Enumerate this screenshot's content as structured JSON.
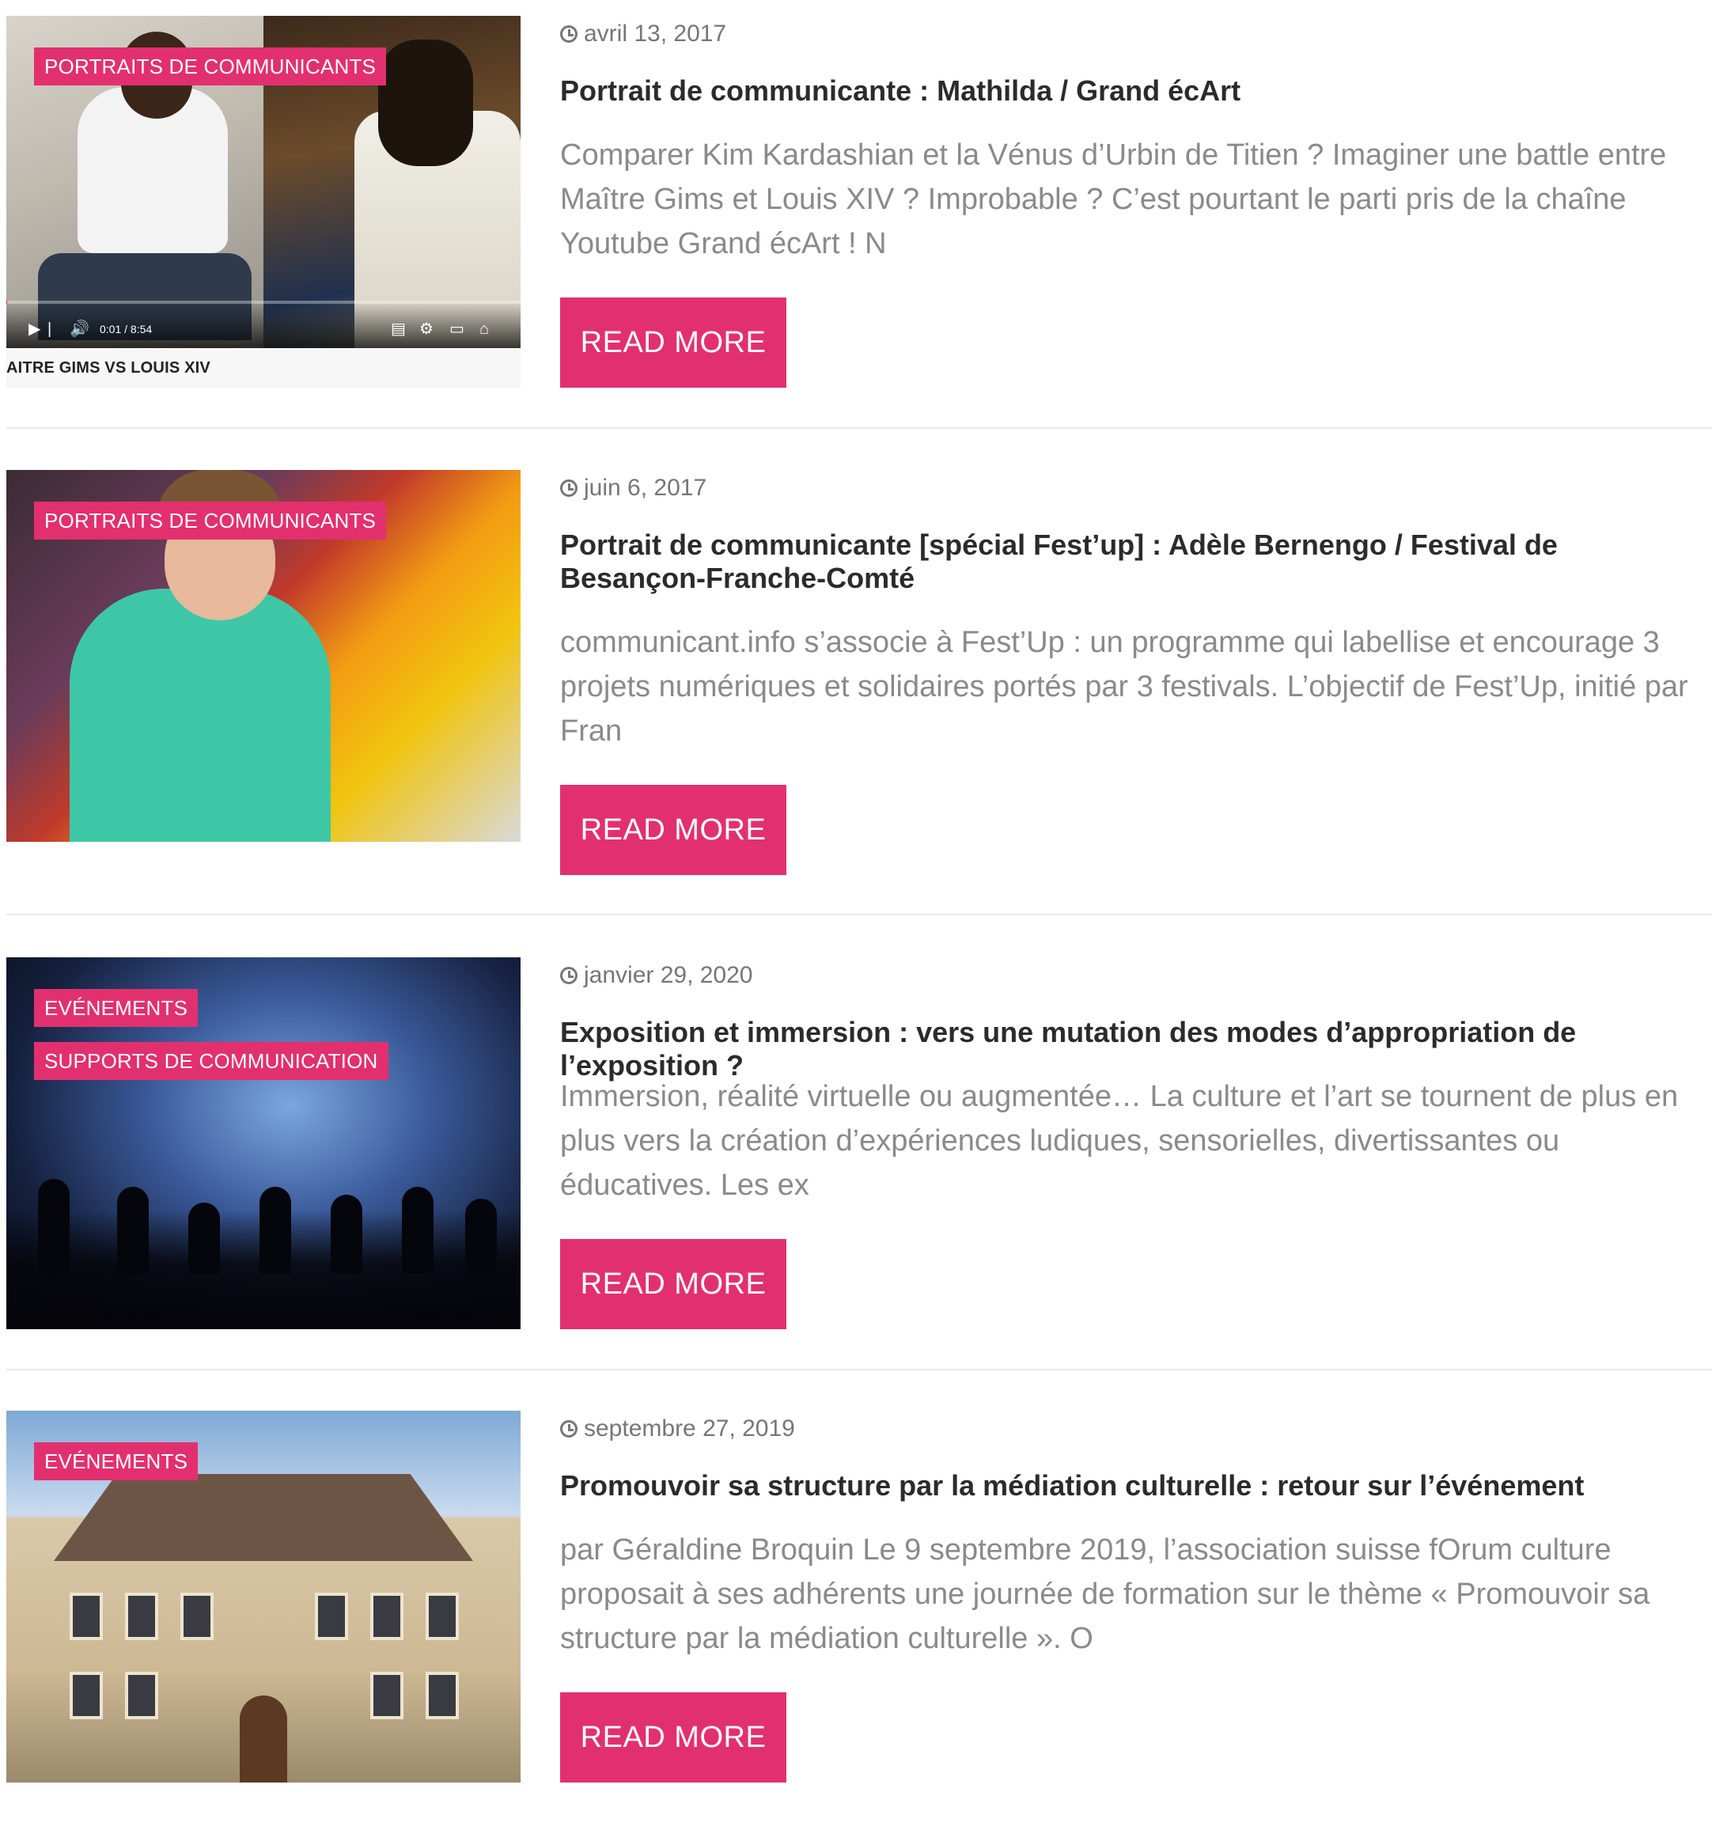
{
  "colors": {
    "accent": "#e2306f",
    "title": "#2b2b2b",
    "excerpt": "#8a8a8a",
    "date": "#767676"
  },
  "posts": [
    {
      "categories": [
        "PORTRAITS DE COMMUNICANTS"
      ],
      "date": "avril 13, 2017",
      "title": "Portrait de communicante : Mathilda / Grand écArt",
      "excerpt": "Comparer Kim Kardashian et la Vénus d’Urbin de Titien ? Imaginer une battle entre Maître Gims et Louis XIV ?  Improbable ? C’est pourtant le parti pris de la chaîne Youtube Grand écArt ! N",
      "read_more": "READ MORE",
      "thumbnail": {
        "video_time": "0:01 / 8:54",
        "progress": 0.002,
        "caption": "AITRE GIMS VS LOUIS XIV"
      }
    },
    {
      "categories": [
        "PORTRAITS DE COMMUNICANTS"
      ],
      "date": "juin 6, 2017",
      "title": "Portrait de communicante [spécial Fest’up] : Adèle Bernengo / Festival de Besançon-Franche-Comté",
      "excerpt": "communicant.info s’associe à Fest’Up : un programme qui labellise et encourage 3 projets numériques et solidaires portés par 3 festivals. L’objectif de Fest’Up, initié par Fran",
      "read_more": "READ MORE"
    },
    {
      "categories": [
        "EVÉNEMENTS",
        "SUPPORTS DE COMMUNICATION"
      ],
      "date": "janvier 29, 2020",
      "title": "Exposition et immersion : vers une mutation des modes d’appropriation de l’exposition ?",
      "excerpt": "Immersion, réalité virtuelle ou augmentée… La culture et l’art se tournent de plus en plus vers la création d’expériences ludiques, sensorielles, divertissantes ou éducatives. Les ex",
      "read_more": "READ MORE"
    },
    {
      "categories": [
        "EVÉNEMENTS"
      ],
      "date": "septembre 27, 2019",
      "title": "Promouvoir sa structure par la médiation culturelle : retour sur l’événement",
      "excerpt": "par Géraldine Broquin Le 9 septembre 2019, l’association suisse fOrum culture proposait à ses adhérents une journée de formation sur le thème « Promouvoir sa structure par la médiation culturelle ». O",
      "read_more": "READ MORE"
    }
  ]
}
